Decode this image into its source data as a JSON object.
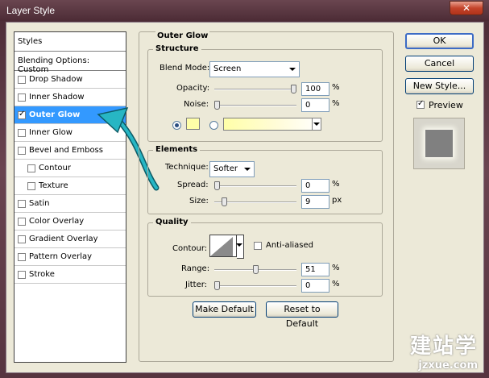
{
  "window": {
    "title": "Layer Style",
    "close_label": "✕"
  },
  "styles_panel": {
    "header": "Styles",
    "blending": "Blending Options: Custom",
    "items": [
      {
        "label": "Drop Shadow",
        "checked": false
      },
      {
        "label": "Inner Shadow",
        "checked": false
      },
      {
        "label": "Outer Glow",
        "checked": true
      },
      {
        "label": "Inner Glow",
        "checked": false
      },
      {
        "label": "Bevel and Emboss",
        "checked": false
      },
      {
        "label": "Contour",
        "checked": false
      },
      {
        "label": "Texture",
        "checked": false
      },
      {
        "label": "Satin",
        "checked": false
      },
      {
        "label": "Color Overlay",
        "checked": false
      },
      {
        "label": "Gradient Overlay",
        "checked": false
      },
      {
        "label": "Pattern Overlay",
        "checked": false
      },
      {
        "label": "Stroke",
        "checked": false
      }
    ]
  },
  "outer_glow": {
    "title": "Outer Glow",
    "structure": {
      "title": "Structure",
      "blend_mode_label": "Blend Mode:",
      "blend_mode_value": "Screen",
      "opacity_label": "Opacity:",
      "opacity_value": "100",
      "opacity_unit": "%",
      "opacity_level": 100,
      "noise_label": "Noise:",
      "noise_value": "0",
      "noise_unit": "%",
      "noise_level": 0,
      "glow_color": "#ffffa8"
    },
    "elements": {
      "title": "Elements",
      "technique_label": "Technique:",
      "technique_value": "Softer",
      "spread_label": "Spread:",
      "spread_value": "0",
      "spread_unit": "%",
      "spread_level": 0,
      "size_label": "Size:",
      "size_value": "9",
      "size_unit": "px",
      "size_level": 9
    },
    "quality": {
      "title": "Quality",
      "contour_label": "Contour:",
      "anti_aliased_label": "Anti-aliased",
      "range_label": "Range:",
      "range_value": "51",
      "range_unit": "%",
      "range_level": 51,
      "jitter_label": "Jitter:",
      "jitter_value": "0",
      "jitter_unit": "%",
      "jitter_level": 0
    },
    "make_default": "Make Default",
    "reset_default": "Reset to Default"
  },
  "buttons": {
    "ok": "OK",
    "cancel": "Cancel",
    "new_style": "New Style...",
    "preview_label": "Preview"
  },
  "watermark": {
    "cn": "建站学",
    "url": "jzxue.com"
  }
}
